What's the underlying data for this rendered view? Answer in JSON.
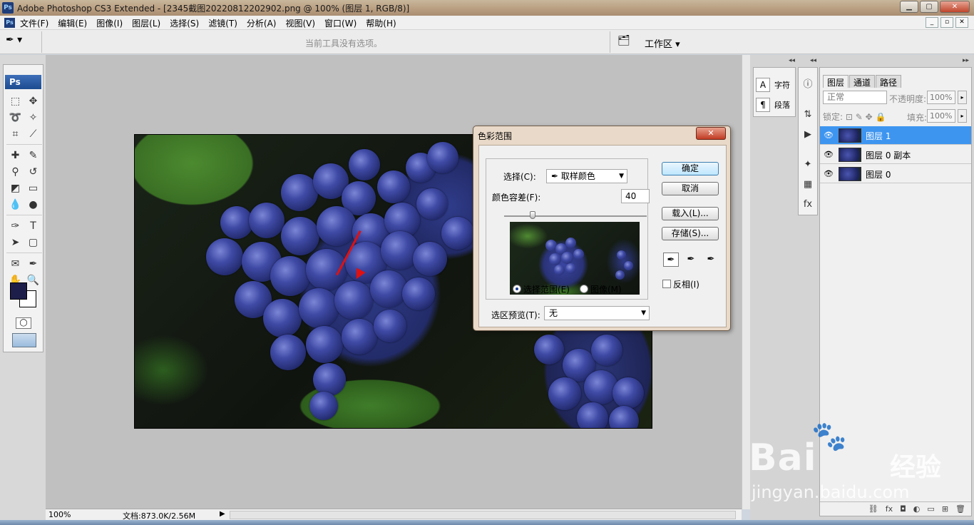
{
  "window": {
    "title": "Adobe Photoshop CS3 Extended - [2345截图20220812202902.png @ 100% (图层 1, RGB/8)]",
    "ps_logo": "Ps"
  },
  "menu": {
    "items": [
      "文件(F)",
      "编辑(E)",
      "图像(I)",
      "图层(L)",
      "选择(S)",
      "滤镜(T)",
      "分析(A)",
      "视图(V)",
      "窗口(W)",
      "帮助(H)"
    ]
  },
  "options_bar": {
    "message": "当前工具没有选项。",
    "workspace_label": "工作区"
  },
  "toolbox": {
    "header": "Ps",
    "colors": {
      "foreground": "#1e1e4a",
      "background": "#ffffff"
    }
  },
  "status_bar": {
    "zoom": "100%",
    "doc_info": "文档:873.0K/2.56M"
  },
  "dialog": {
    "title": "色彩范围",
    "select_label": "选择(C):",
    "select_value": "取样颜色",
    "fuzziness_label": "颜色容差(F):",
    "fuzziness_value": "40",
    "fuzziness_level": 0.2,
    "radio_selection": "选择范围(E)",
    "radio_image": "图像(M)",
    "selected_radio": "选择范围(E)",
    "preview_label": "选区预览(T):",
    "preview_value": "无",
    "buttons": {
      "ok": "确定",
      "cancel": "取消",
      "load": "载入(L)...",
      "save": "存储(S)..."
    },
    "invert_label": "反相(I)",
    "invert_checked": false
  },
  "dock": {
    "character_label": "字符",
    "paragraph_label": "段落"
  },
  "layers_panel": {
    "tabs": [
      "图层",
      "通道",
      "路径"
    ],
    "active_tab": "图层",
    "blend_mode": "正常",
    "opacity_label": "不透明度:",
    "opacity_value": "100%",
    "lock_label": "锁定:",
    "fill_label": "填充:",
    "fill_value": "100%",
    "layers": [
      {
        "name": "图层 1",
        "selected": true
      },
      {
        "name": "图层 0 副本",
        "selected": false
      },
      {
        "name": "图层 0",
        "selected": false
      }
    ]
  },
  "watermark": {
    "brand": "Bai",
    "brand_cn": "经验",
    "url": "jingyan.baidu.com"
  },
  "colors": {
    "selection": "#3e95f0",
    "arrow": "#e01010"
  }
}
